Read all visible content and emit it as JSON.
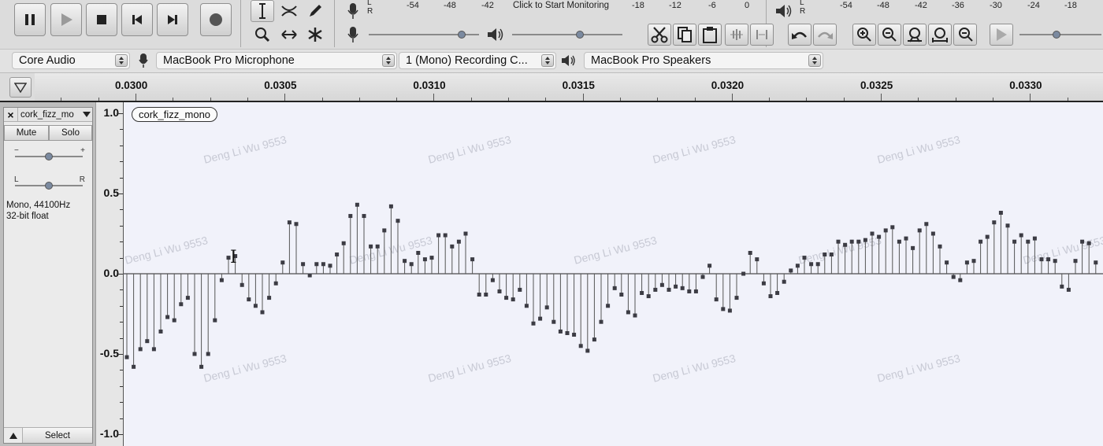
{
  "toolbar": {
    "transport": {
      "pause": "pause-icon",
      "play": "play-icon",
      "stop": "stop-icon",
      "skip_start": "skip-to-start-icon",
      "skip_end": "skip-to-end-icon",
      "record": "record-icon"
    },
    "tools": [
      "selection-tool",
      "envelope-tool",
      "draw-tool",
      "zoom-tool",
      "time-shift-tool",
      "multi-tool"
    ],
    "record_meter": {
      "channels": [
        "L",
        "R"
      ],
      "scale": [
        "-54",
        "-48",
        "-42",
        "Click to Start Monitoring",
        "-18",
        "-12",
        "-6",
        "0"
      ]
    },
    "play_meter": {
      "channels": [
        "L",
        "R"
      ],
      "scale": [
        "-54",
        "-48",
        "-42",
        "-36",
        "-30",
        "-24",
        "-18"
      ]
    },
    "mixer": {
      "rec_volume_level": 0.87,
      "play_volume_level": 0.62,
      "play_speed_level": 0.45
    },
    "edit_tools": [
      "cut-icon",
      "copy-icon",
      "paste-icon",
      "trim-icon",
      "silence-icon",
      "undo-icon",
      "redo-icon",
      "zoom-in-icon",
      "zoom-out-icon",
      "fit-selection-icon",
      "fit-project-icon",
      "zoom-toggle-icon",
      "play-at-speed-icon"
    ]
  },
  "device_toolbar": {
    "host": "Core Audio",
    "recording_device": "MacBook Pro Microphone",
    "channels": "1 (Mono) Recording C...",
    "playback_device": "MacBook Pro Speakers"
  },
  "timeline": {
    "labels": [
      "0.0300",
      "0.0305",
      "0.0310",
      "0.0315",
      "0.0320",
      "0.0325",
      "0.0330"
    ]
  },
  "track": {
    "name": "cork_fizz_mo",
    "clip_name": "cork_fizz_mono",
    "mute_label": "Mute",
    "solo_label": "Solo",
    "gain_minus": "−",
    "gain_plus": "+",
    "pan_left": "L",
    "pan_right": "R",
    "gain_level": 0.5,
    "pan_level": 0.5,
    "format_line1": "Mono, 44100Hz",
    "format_line2": "32-bit float",
    "select_label": "Select"
  },
  "amplitude_ruler": {
    "labels": [
      "1.0",
      "0.5",
      "0.0",
      "-0.5",
      "-1.0"
    ]
  },
  "watermark": "Deng Li Wu 9553",
  "colors": {
    "waveform": "#3c3c44",
    "background": "#f1f2fa",
    "record_red": "#cc2222"
  },
  "samples": [
    -0.52,
    -0.58,
    -0.47,
    -0.42,
    -0.47,
    -0.36,
    -0.27,
    -0.29,
    -0.19,
    -0.15,
    -0.5,
    -0.58,
    -0.5,
    -0.29,
    -0.04,
    0.1,
    0.11,
    -0.07,
    -0.16,
    -0.2,
    -0.24,
    -0.15,
    -0.06,
    0.07,
    0.32,
    0.31,
    0.06,
    -0.01,
    0.06,
    0.06,
    0.05,
    0.12,
    0.19,
    0.36,
    0.43,
    0.36,
    0.17,
    0.17,
    0.27,
    0.42,
    0.33,
    0.08,
    0.06,
    0.13,
    0.09,
    0.1,
    0.24,
    0.24,
    0.17,
    0.2,
    0.25,
    0.09,
    -0.13,
    -0.13,
    -0.04,
    -0.11,
    -0.15,
    -0.16,
    -0.1,
    -0.2,
    -0.31,
    -0.28,
    -0.21,
    -0.3,
    -0.36,
    -0.37,
    -0.38,
    -0.45,
    -0.48,
    -0.41,
    -0.3,
    -0.2,
    -0.09,
    -0.13,
    -0.24,
    -0.26,
    -0.12,
    -0.14,
    -0.1,
    -0.07,
    -0.1,
    -0.08,
    -0.09,
    -0.11,
    -0.11,
    -0.02,
    0.05,
    -0.16,
    -0.22,
    -0.23,
    -0.15,
    0.0,
    0.13,
    0.09,
    -0.06,
    -0.14,
    -0.12,
    -0.05,
    0.02,
    0.05,
    0.1,
    0.06,
    0.06,
    0.12,
    0.12,
    0.2,
    0.18,
    0.2,
    0.2,
    0.21,
    0.25,
    0.23,
    0.27,
    0.29,
    0.2,
    0.22,
    0.16,
    0.27,
    0.31,
    0.25,
    0.17,
    0.07,
    -0.02,
    -0.04,
    0.07,
    0.08,
    0.2,
    0.23,
    0.32,
    0.38,
    0.3,
    0.2,
    0.24,
    0.2,
    0.22,
    0.09,
    0.09,
    0.08,
    -0.08,
    -0.1,
    0.08,
    0.2,
    0.19,
    0.07,
    0.06,
    -0.03,
    0.05,
    0.05
  ]
}
